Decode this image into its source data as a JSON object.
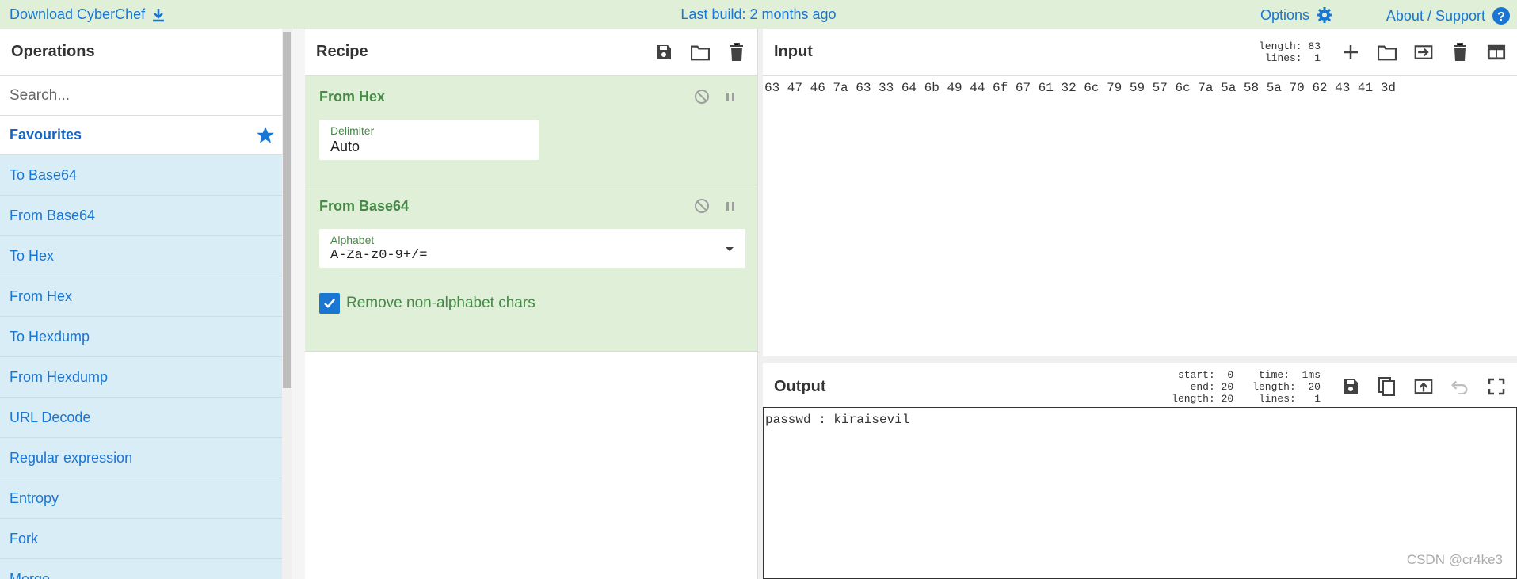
{
  "banner": {
    "download_label": "Download CyberChef",
    "build_label": "Last build: 2 months ago",
    "options_label": "Options",
    "about_label": "About / Support"
  },
  "operations": {
    "title": "Operations",
    "search_placeholder": "Search...",
    "favourites_label": "Favourites",
    "items": [
      "To Base64",
      "From Base64",
      "To Hex",
      "From Hex",
      "To Hexdump",
      "From Hexdump",
      "URL Decode",
      "Regular expression",
      "Entropy",
      "Fork",
      "Merge"
    ]
  },
  "recipe": {
    "title": "Recipe",
    "steps": [
      {
        "name": "From Hex",
        "field_label": "Delimiter",
        "field_value": "Auto"
      },
      {
        "name": "From Base64",
        "field_label": "Alphabet",
        "field_value": "A-Za-z0-9+/=",
        "checkbox_label": "Remove non-alphabet chars",
        "checkbox_checked": true
      }
    ]
  },
  "input": {
    "title": "Input",
    "stats": "length: 83\n lines:  1",
    "text": "63 47 46 7a 63 33 64 6b 49 44 6f 67 61 32 6c 79 59 57 6c 7a 5a 58 5a 70 62 43 41 3d"
  },
  "output": {
    "title": "Output",
    "stats_left": "start:  0\n  end: 20\nlength: 20",
    "stats_right": "time:  1ms\nlength:  20\nlines:   1",
    "text": "passwd : kiraisevil"
  },
  "watermark": "CSDN @cr4ke3",
  "colors": {
    "accent": "#1976d2",
    "recipe_bg": "#dfefd8",
    "ops_bg": "#d9edf7"
  }
}
